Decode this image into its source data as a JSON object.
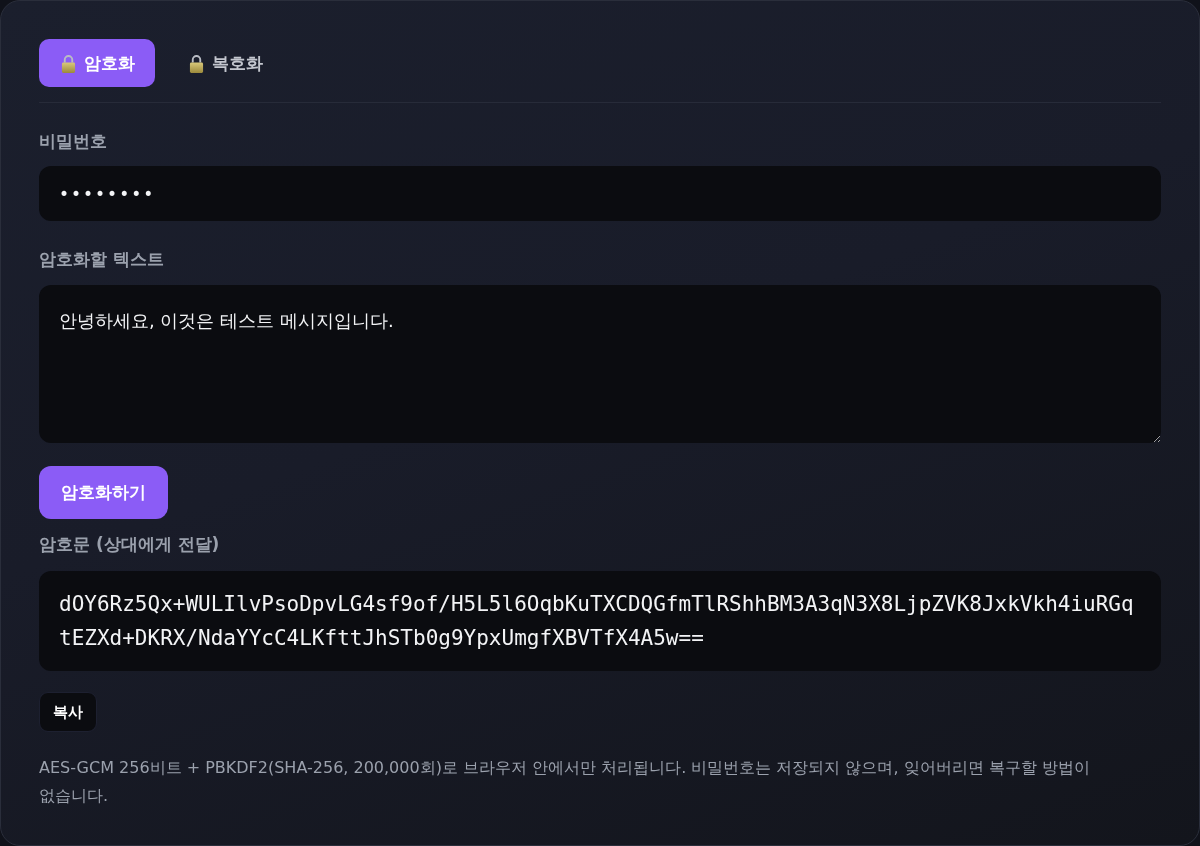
{
  "tabs": [
    {
      "label": "암호화",
      "selected": true
    },
    {
      "label": "복호화",
      "selected": false
    }
  ],
  "password": {
    "label": "비밀번호",
    "value": "••••••••"
  },
  "plaintext": {
    "label": "암호화할 텍스트",
    "value": "안녕하세요, 이것은 테스트 메시지입니다."
  },
  "encrypt_button": "암호화하기",
  "ciphertext": {
    "label": "암호문 (상대에게 전달)",
    "value": "dOY6Rz5Qx+WULIlvPsoDpvLG4sf9of/H5L5l6OqbKuTXCDQGfmTlRShhBM3A3qN3X8LjpZVK8JxkVkh4iuRGqtEZXd+DKRX/NdaYYcC4LKfttJhSTb0g9YpxUmgfXBVTfX4A5w=="
  },
  "copy_button": "복사",
  "note": "AES-GCM 256비트 + PBKDF2(SHA-256, 200,000회)로 브라우저 안에서만 처리됩니다. 비밀번호는 저장되지 않으며, 잊어버리면 복구할 방법이 없습니다."
}
